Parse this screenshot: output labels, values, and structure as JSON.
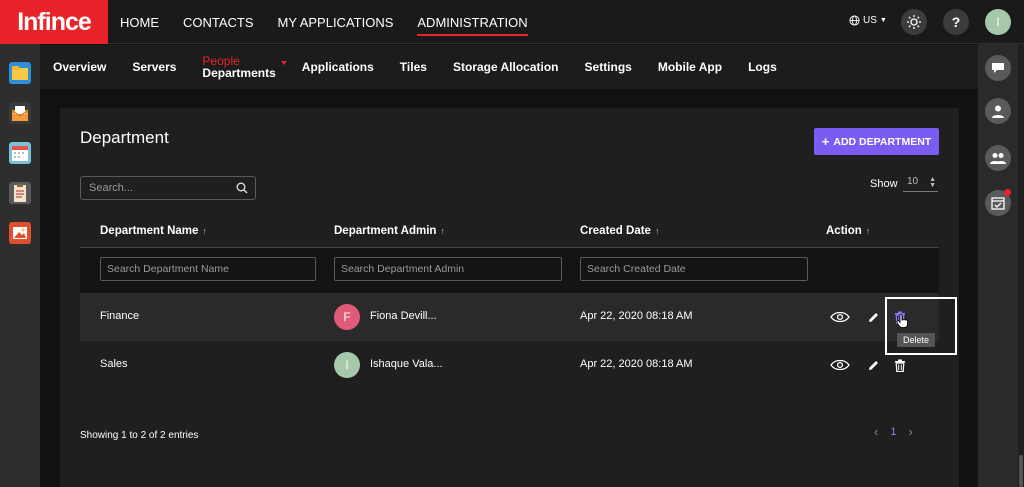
{
  "topbar": {
    "logo_text": "Infince",
    "nav": [
      "HOME",
      "CONTACTS",
      "MY APPLICATIONS",
      "ADMINISTRATION"
    ],
    "active_nav": "ADMINISTRATION",
    "language": "US",
    "help_label": "?",
    "user_initial": "I"
  },
  "subnav": {
    "items": [
      "Overview",
      "Servers",
      "Applications",
      "Tiles",
      "Storage Allocation",
      "Settings",
      "Mobile App",
      "Logs"
    ],
    "people_top": "People",
    "people_bottom": "Departments"
  },
  "page": {
    "title": "Department",
    "add_button": "ADD DEPARTMENT",
    "search_placeholder": "Search...",
    "show_label": "Show",
    "show_value": "10"
  },
  "table": {
    "columns": [
      "Department Name",
      "Department Admin",
      "Created Date",
      "Action"
    ],
    "filters": [
      "Search Department Name",
      "Search Department Admin",
      "Search Created Date"
    ],
    "rows": [
      {
        "name": "Finance",
        "admin_initial": "F",
        "admin": "Fiona Devill...",
        "created": "Apr 22, 2020 08:18 AM",
        "avatar_color": "#e05a7a"
      },
      {
        "name": "Sales",
        "admin_initial": "I",
        "admin": "Ishaque Vala...",
        "created": "Apr 22, 2020 08:18 AM",
        "avatar_color": "#a5c9aa"
      }
    ]
  },
  "footer": {
    "showing": "Showing 1 to 2 of 2 entries",
    "page": "1"
  },
  "tooltip": "Delete",
  "colors": {
    "brand": "#e8242a",
    "accent": "#7b5cf0"
  }
}
